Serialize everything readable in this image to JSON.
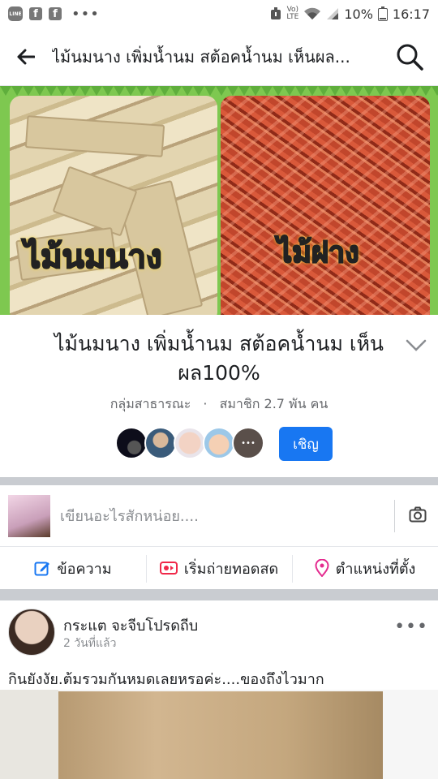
{
  "status_bar": {
    "time": "16:17",
    "battery": "10%",
    "network": "LTE",
    "line_app": "LINE",
    "volte": "Vo)",
    "icons": [
      "line-icon",
      "facebook-icon",
      "facebook-icon",
      "more-dots-icon",
      "alarm-icon",
      "volte-icon",
      "wifi-icon",
      "signal-icon",
      "battery-icon"
    ]
  },
  "header": {
    "title": "ไม้นมนาง เพิ่มน้ำนม สต้อคน้ำนม  เห็นผล..."
  },
  "cover": {
    "label_left": "ไม้นมนาง",
    "label_right": "ไม้ฝาง"
  },
  "group": {
    "name": "ไม้นมนาง เพิ่มน้ำนม สต้อคน้ำนม เห็นผล100%",
    "privacy": "กลุ่มสาธารณะ",
    "separator": "·",
    "members": "สมาชิก 2.7 พัน คน",
    "invite_label": "เชิญ"
  },
  "composer": {
    "placeholder": "เขียนอะไรสักหน่อย...."
  },
  "actions": [
    {
      "label": "ข้อความ",
      "icon": "edit-icon"
    },
    {
      "label": "เริ่มถ่ายทอดสด",
      "icon": "live-video-icon"
    },
    {
      "label": "ตำแหน่งที่ตั้ง",
      "icon": "location-pin-icon"
    }
  ],
  "post": {
    "author": "กระแต จะจีบโปรดถีบ",
    "time": "2 วันที่แล้ว",
    "text": "กินยังงัย.ต้มรวมกันหมดเลยหรอค่ะ....ของถึงไวมาก"
  },
  "colors": {
    "accent": "#1877f2",
    "cover_green": "#7ec850",
    "live_red": "#f02849",
    "location_pink": "#e42b8f"
  }
}
